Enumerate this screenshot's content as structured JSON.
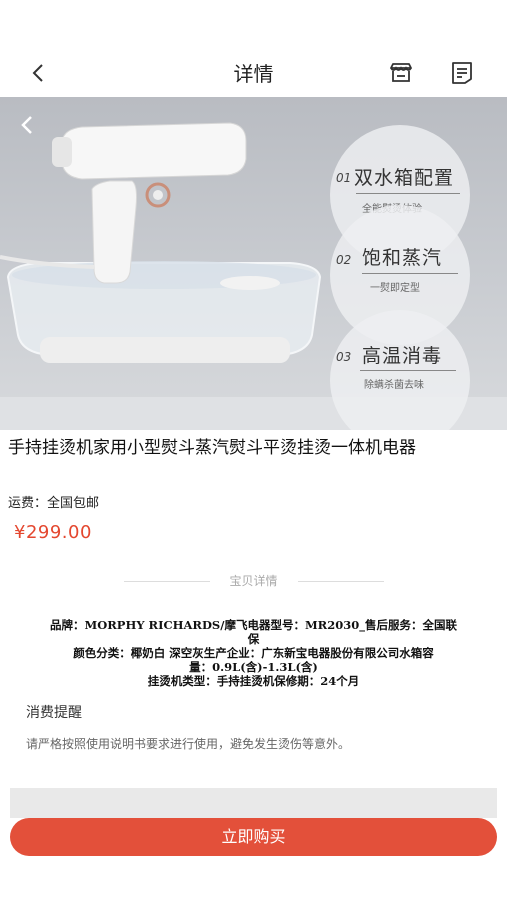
{
  "header": {
    "title": "详情"
  },
  "hero": {
    "features": [
      {
        "num": "01",
        "title": "双水箱配置",
        "subtitle": "全能熨烫体验"
      },
      {
        "num": "02",
        "title": "饱和蒸汽",
        "subtitle": "一熨即定型"
      },
      {
        "num": "03",
        "title": "高温消毒",
        "subtitle": "除螨杀菌去味"
      }
    ]
  },
  "product": {
    "title": "手持挂烫机家用小型熨斗蒸汽熨斗平烫挂烫一体机电器",
    "shipping": "运费：全国包邮",
    "price": "¥299.00"
  },
  "details": {
    "section_label": "宝贝详情",
    "spec_lines": [
      "品牌：MORPHY RICHARDS/摩飞电器型号：MR2030_售后服务：全国联",
      "保",
      "颜色分类：椰奶白 深空灰生产企业：广东新宝电器股份有限公司水箱容",
      "量：0.9L(含)-1.3L(含)",
      "挂烫机类型：手持挂烫机保修期：24个月"
    ]
  },
  "notice": {
    "title": "消费提醒",
    "text": "请严格按照使用说明书要求进行使用，避免发生烫伤等意外。"
  },
  "actions": {
    "buy_label": "立即购买"
  },
  "colors": {
    "accent": "#e3503a",
    "price": "#e4472f"
  }
}
